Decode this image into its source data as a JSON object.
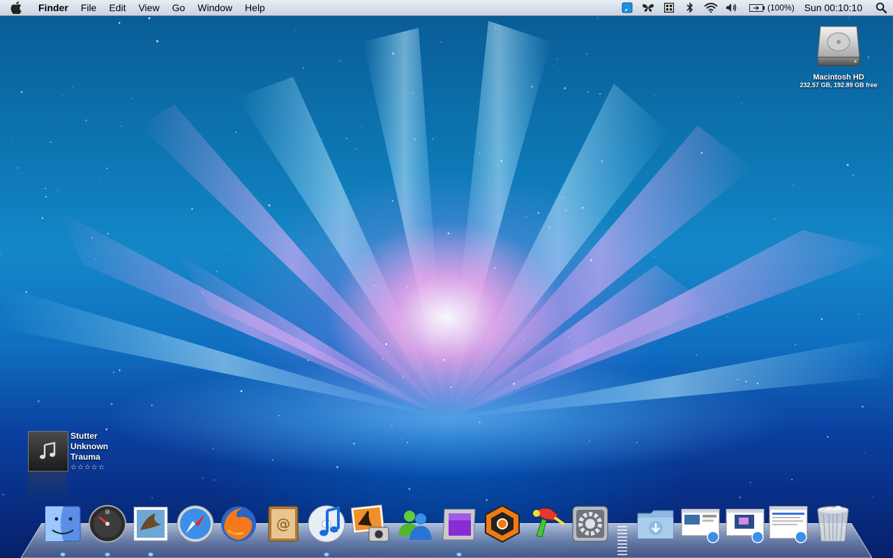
{
  "menubar": {
    "apple_icon": "apple-icon",
    "items": [
      {
        "label": "Finder",
        "bold": true
      },
      {
        "label": "File"
      },
      {
        "label": "Edit"
      },
      {
        "label": "View"
      },
      {
        "label": "Go"
      },
      {
        "label": "Window"
      },
      {
        "label": "Help"
      }
    ],
    "status_icons": [
      "notes-icon",
      "butterfly-icon",
      "menu-extra-icon",
      "bluetooth-icon",
      "wifi-icon",
      "volume-icon"
    ],
    "battery_icon": "battery-icon",
    "battery_label": "(100%)",
    "clock": "Sun 00:10:10",
    "spotlight_icon": "spotlight-search-icon"
  },
  "desktop": {
    "hard_drive": {
      "icon": "hard-drive-icon",
      "name": "Macintosh HD",
      "info": "232.57 GB, 192.89 GB free"
    }
  },
  "now_playing": {
    "icon": "music-note-icon",
    "title": "Stutter",
    "artist": "Unknown",
    "album": "Trauma",
    "rating_display": "☆☆☆☆☆",
    "rating": 0
  },
  "dock": {
    "items": [
      {
        "name": "finder-icon",
        "running": true
      },
      {
        "name": "dashboard-icon",
        "running": true
      },
      {
        "name": "mail-icon",
        "running": true
      },
      {
        "name": "safari-icon",
        "running": false
      },
      {
        "name": "firefox-icon",
        "running": false
      },
      {
        "name": "address-book-icon",
        "running": false
      },
      {
        "name": "itunes-icon",
        "running": true
      },
      {
        "name": "iphoto-icon",
        "running": false
      },
      {
        "name": "messenger-icon",
        "running": false
      },
      {
        "name": "purple-app-icon",
        "running": true
      },
      {
        "name": "reason-icon",
        "running": false
      },
      {
        "name": "toy-raygun-icon",
        "running": false
      },
      {
        "name": "system-preferences-icon",
        "running": false
      },
      {
        "name": "downloads-folder-icon",
        "running": false
      },
      {
        "name": "safari-webpage-1-icon",
        "running": false
      },
      {
        "name": "safari-webpage-2-icon",
        "running": false
      },
      {
        "name": "safari-webpage-3-icon",
        "running": false
      },
      {
        "name": "trash-icon",
        "running": false
      }
    ]
  }
}
